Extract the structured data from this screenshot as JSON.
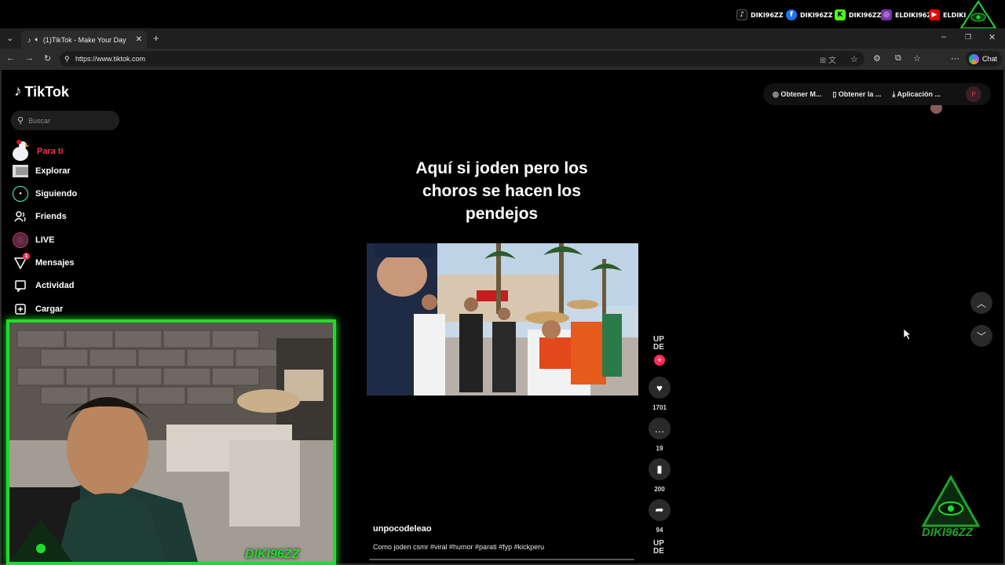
{
  "overlay": {
    "socials": [
      {
        "platform": "tiktok",
        "icon": "tiktok-icon",
        "handle": "DIKI96ZZ"
      },
      {
        "platform": "facebook",
        "icon": "facebook-icon",
        "handle": "DIKI96ZZ"
      },
      {
        "platform": "kick",
        "icon": "kick-icon",
        "handle": "DIKI96ZZ"
      },
      {
        "platform": "instagram",
        "icon": "instagram-icon",
        "handle": "ELDIKI96ZZ"
      },
      {
        "platform": "youtube",
        "icon": "youtube-icon",
        "handle": "ELDIKI"
      }
    ],
    "webcam_tag": "DIKI96ZZ",
    "watermark_text": "DIKI96ZZ",
    "accent_color": "#1fdc2a"
  },
  "browser": {
    "tab_title": "(1)TikTok - Make Your Day",
    "url": "https://www.tiktok.com",
    "chat_label": "Chat"
  },
  "tiktok": {
    "logo_text": "TikTok",
    "search_placeholder": "Buscar",
    "nav": [
      {
        "label": "Para ti",
        "icon": "home-icon",
        "active": true
      },
      {
        "label": "Explorar",
        "icon": "compass-icon"
      },
      {
        "label": "Siguiendo",
        "icon": "following-icon"
      },
      {
        "label": "Friends",
        "icon": "friends-icon"
      },
      {
        "label": "LIVE",
        "icon": "live-icon"
      },
      {
        "label": "Mensajes",
        "icon": "messages-icon",
        "badge": "1"
      },
      {
        "label": "Actividad",
        "icon": "activity-icon"
      },
      {
        "label": "Cargar",
        "icon": "upload-icon"
      }
    ],
    "top_actions": [
      {
        "label": "Obtener M...",
        "icon": "coin-icon"
      },
      {
        "label": "Obtener la ...",
        "icon": "phone-icon"
      },
      {
        "label": "Aplicación ...",
        "icon": "download-icon"
      }
    ],
    "profile_initial": "P",
    "video": {
      "overlay_caption": "Aquí si joden pero los choros se hacen los pendejos",
      "author": "unpocodeleao",
      "description": "Como joden csmr #viral #humor #parati #fyp #kickperu",
      "likes": "1701",
      "comments": "19",
      "saves": "200",
      "shares": "94",
      "author_avatar_text": "UP DE"
    }
  }
}
